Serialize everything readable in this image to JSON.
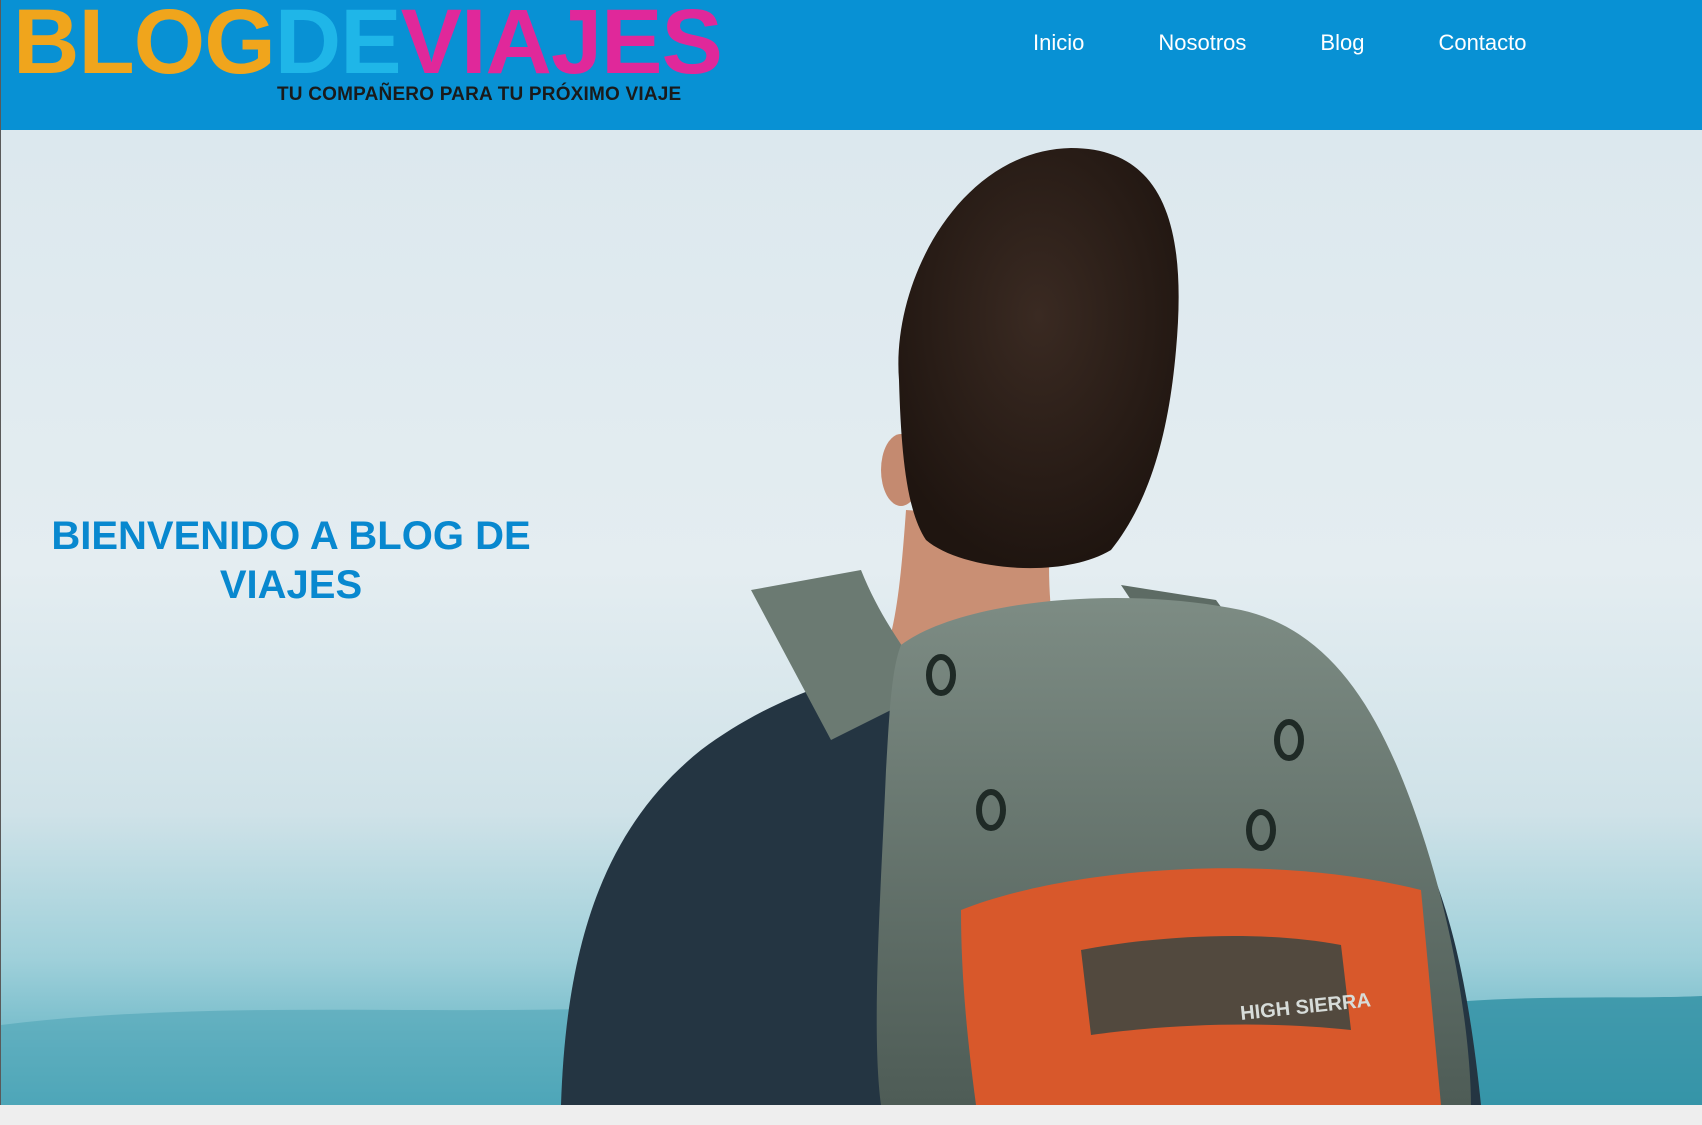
{
  "logo": {
    "part1": "BLOG",
    "part2": "DE",
    "part3": "VIAJES",
    "tagline": "TU COMPAÑERO PARA TU PRÓXIMO VIAJE",
    "colors": {
      "part1": "#f0a51c",
      "part2": "#1fb6e8",
      "part3": "#e0289a"
    }
  },
  "nav": {
    "items": [
      {
        "label": "Inicio"
      },
      {
        "label": "Nosotros"
      },
      {
        "label": "Blog"
      },
      {
        "label": "Contacto"
      }
    ]
  },
  "hero": {
    "title": "BIENVENIDO A BLOG DE VIAJES",
    "image_subject": "hiker with backpack looking at sky",
    "backpack_brand": "HIGH SIERRA"
  },
  "colors": {
    "header_bg": "#0891d4",
    "hero_title": "#0888cf"
  }
}
